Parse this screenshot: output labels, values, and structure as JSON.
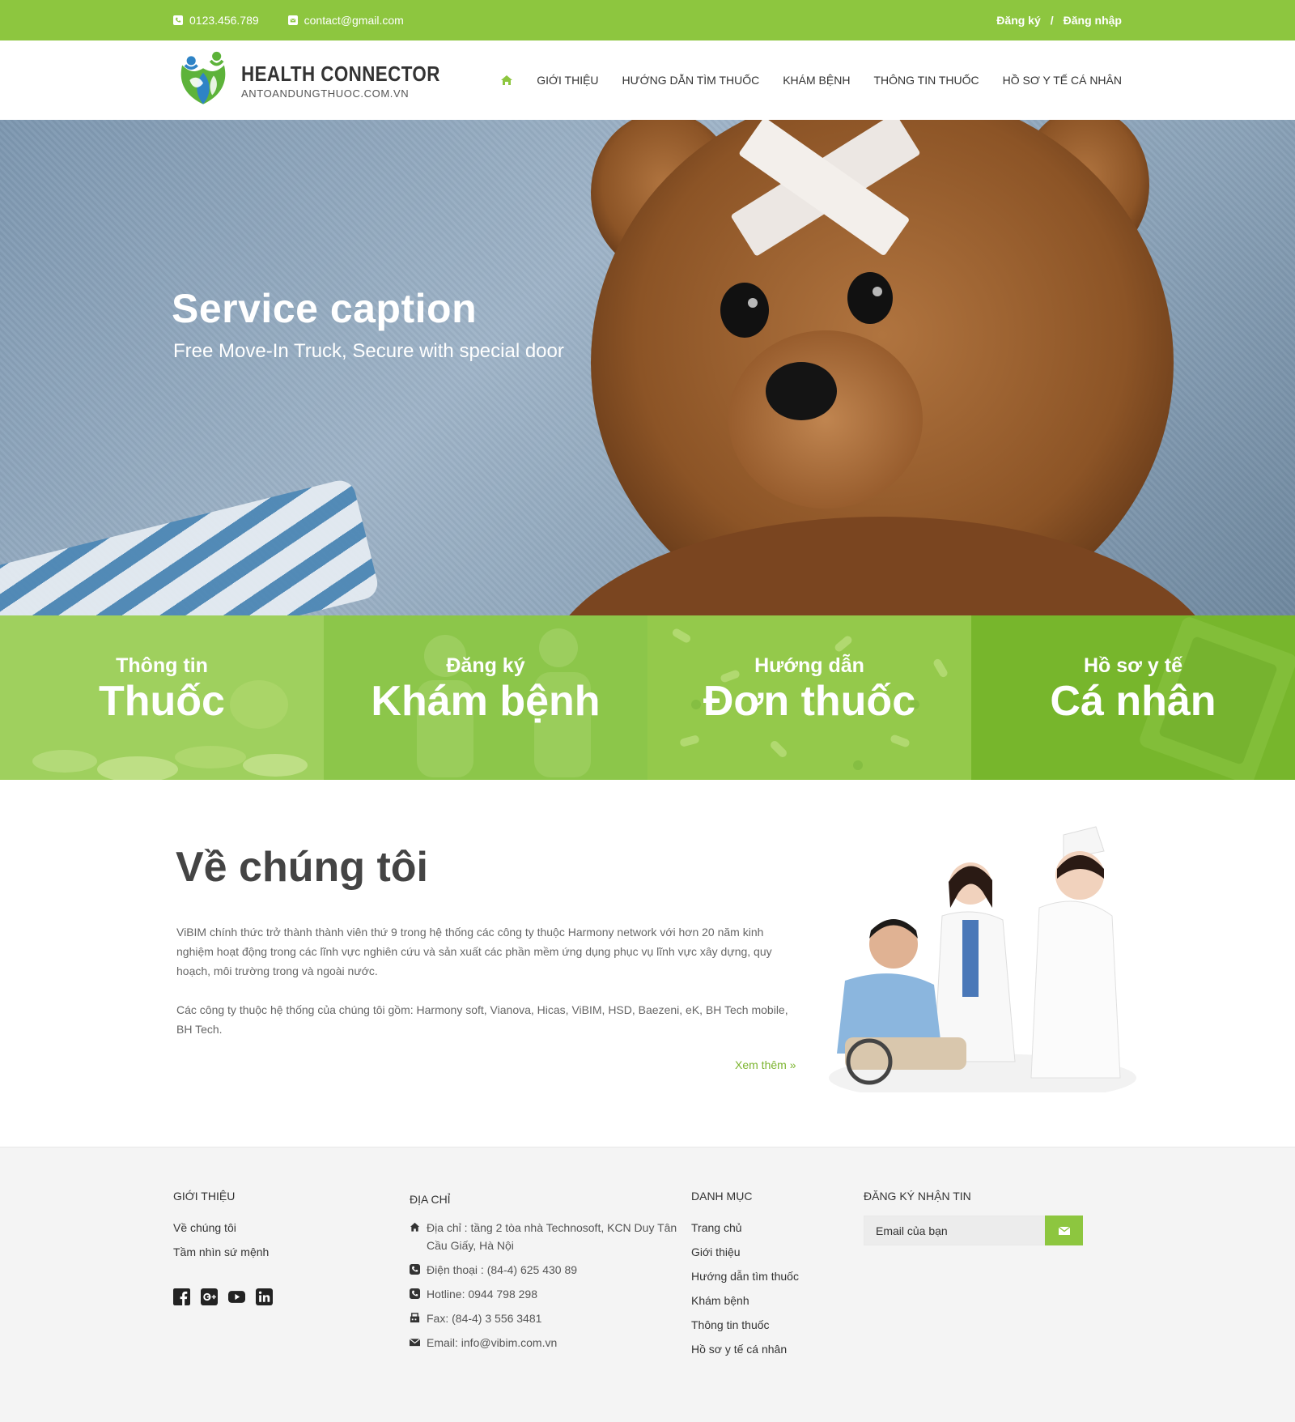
{
  "topbar": {
    "phone": "0123.456.789",
    "email": "contact@gmail.com",
    "register": "Đăng ký",
    "separator": "/",
    "login": "Đăng nhập"
  },
  "brand": {
    "name": "HEALTH CONNECTOR",
    "domain": "ANTOANDUNGTHUOC.COM.VN"
  },
  "nav": {
    "items": [
      "GIỚI THIỆU",
      "HƯỚNG DẪN TÌM THUỐC",
      "KHÁM BỆNH",
      "THÔNG TIN THUỐC",
      "HỒ SƠ Y TẾ CÁ NHÂN"
    ]
  },
  "hero": {
    "title": "Service caption",
    "subtitle": "Free Move-In Truck, Secure with special door"
  },
  "tiles": [
    {
      "small": "Thông tin",
      "big": "Thuốc"
    },
    {
      "small": "Đăng ký",
      "big": "Khám bệnh"
    },
    {
      "small": "Hướng dẫn",
      "big": "Đơn thuốc"
    },
    {
      "small": "Hồ sơ y tế",
      "big": "Cá nhân"
    }
  ],
  "about": {
    "title": "Về chúng tôi",
    "p1": "ViBIM chính thức trở thành thành viên thứ 9 trong hệ thống các công ty thuộc Harmony network với hơn 20 năm kinh nghiệm hoạt động trong các lĩnh vực nghiên cứu và sản xuất các phần mềm ứng dụng phục vụ lĩnh vực xây dựng, quy hoạch, môi trường trong và ngoài nước.",
    "p2": "Các công ty thuộc hệ thống của chúng tôi gồm: Harmony soft, Vianova, Hicas, ViBIM, HSD, Baezeni, eK, BH Tech mobile, BH Tech.",
    "more": "Xem thêm »"
  },
  "footer": {
    "intro": {
      "heading": "GIỚI THIỆU",
      "links": [
        "Về chúng tôi",
        "Tầm nhìn sứ mệnh"
      ]
    },
    "address": {
      "heading": "ĐỊA CHỈ",
      "lines": [
        "Địa chỉ : tầng 2 tòa nhà Technosoft, KCN Duy Tân Cầu Giấy, Hà Nội",
        "Điện thoại : (84-4) 625 430 89",
        "Hotline: 0944 798 298",
        "Fax: (84-4) 3 556 3481",
        "Email: info@vibim.com.vn"
      ]
    },
    "menu": {
      "heading": "DANH MỤC",
      "links": [
        "Trang chủ",
        "Giới thiệu",
        "Hướng dẫn tìm thuốc",
        "Khám bệnh",
        "Thông tin thuốc",
        "Hồ sơ y tế cá nhân"
      ]
    },
    "newsletter": {
      "heading": "ĐĂNG KÝ NHẬN TIN",
      "placeholder": "Email của bạn"
    }
  },
  "colors": {
    "accent": "#8dc63f",
    "link": "#7cb42f"
  }
}
